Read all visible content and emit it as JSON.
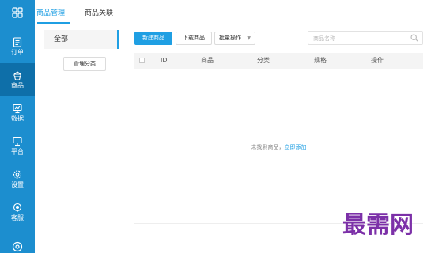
{
  "sidebar": {
    "items": [
      {
        "icon": "order-icon",
        "label": "订单"
      },
      {
        "icon": "product-icon",
        "label": "商品",
        "active": true
      },
      {
        "icon": "data-icon",
        "label": "数据"
      },
      {
        "icon": "platform-icon",
        "label": "平台"
      },
      {
        "icon": "settings-icon",
        "label": "设置"
      },
      {
        "icon": "customer-service-icon",
        "label": "客服"
      }
    ]
  },
  "header": {
    "tabs": [
      {
        "label": "商品管理",
        "active": true
      },
      {
        "label": "商品关联"
      }
    ]
  },
  "category": {
    "all_label": "全部",
    "manage_button": "管理分类"
  },
  "toolbar": {
    "new_label": "新建商品",
    "download_label": "下载商品",
    "batch_label": "批量操作"
  },
  "search": {
    "placeholder": "商品名称",
    "value": ""
  },
  "table": {
    "columns": [
      "ID",
      "商品",
      "分类",
      "规格",
      "操作"
    ],
    "rows": [],
    "empty_text": "未找到商品，",
    "empty_link": "立即添加"
  },
  "watermark": "最需网",
  "colors": {
    "sidebar": "#1c8ecf",
    "sidebar_active": "#0e6fa9",
    "accent": "#1f9fe3",
    "watermark": "#7c30a8"
  }
}
